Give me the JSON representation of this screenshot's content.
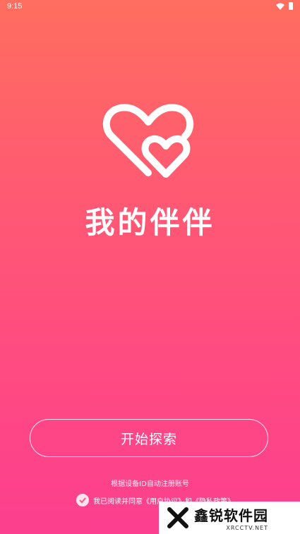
{
  "status_bar": {
    "time": "9:15"
  },
  "app": {
    "name": "我的伴伴"
  },
  "actions": {
    "start_label": "开始探索"
  },
  "footer": {
    "register_hint": "根据设备ID自动注册账号",
    "agree_text": "我已阅读并同意《用户协议》和《隐私政策》"
  },
  "watermark": {
    "name": "鑫锐软件园",
    "url": "XRCCTV.NET"
  }
}
